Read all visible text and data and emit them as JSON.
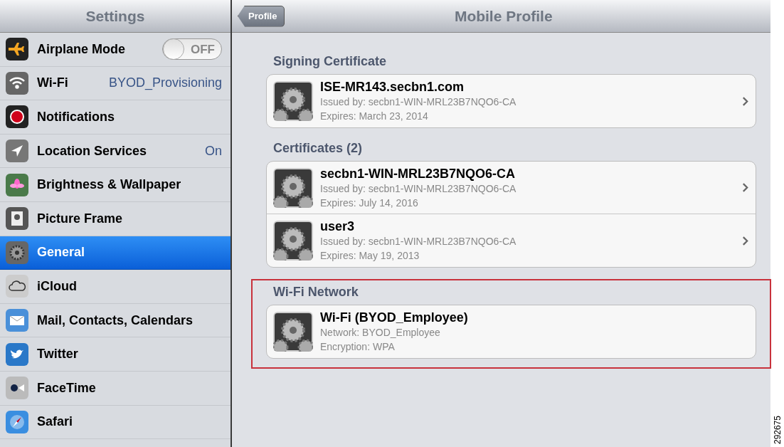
{
  "sidebar": {
    "title": "Settings",
    "items": [
      {
        "label": "Airplane Mode",
        "kind": "toggle",
        "on": false,
        "toggle_text": "OFF",
        "selected": false
      },
      {
        "label": "Wi-Fi",
        "kind": "value",
        "value": "BYOD_Provisioning",
        "selected": false
      },
      {
        "label": "Notifications",
        "kind": "plain",
        "selected": false
      },
      {
        "label": "Location Services",
        "kind": "value",
        "value": "On",
        "selected": false
      },
      {
        "label": "Brightness & Wallpaper",
        "kind": "plain",
        "selected": false
      },
      {
        "label": "Picture Frame",
        "kind": "plain",
        "selected": false
      },
      {
        "label": "General",
        "kind": "plain",
        "selected": true
      },
      {
        "label": "iCloud",
        "kind": "plain",
        "selected": false
      },
      {
        "label": "Mail, Contacts, Calendars",
        "kind": "plain",
        "selected": false
      },
      {
        "label": "Twitter",
        "kind": "plain",
        "selected": false
      },
      {
        "label": "FaceTime",
        "kind": "plain",
        "selected": false
      },
      {
        "label": "Safari",
        "kind": "plain",
        "selected": false
      }
    ]
  },
  "detail": {
    "back_button": "Profile",
    "title": "Mobile Profile",
    "sections": [
      {
        "heading": "Signing Certificate",
        "highlighted": false,
        "items": [
          {
            "name": "ISE-MR143.secbn1.com",
            "lines": [
              "Issued by: secbn1-WIN-MRL23B7NQO6-CA",
              "Expires: March 23, 2014"
            ],
            "disclosure": true
          }
        ]
      },
      {
        "heading": "Certificates (2)",
        "highlighted": false,
        "items": [
          {
            "name": "secbn1-WIN-MRL23B7NQO6-CA",
            "lines": [
              "Issued by: secbn1-WIN-MRL23B7NQO6-CA",
              "Expires: July 14, 2016"
            ],
            "disclosure": true
          },
          {
            "name": "user3",
            "lines": [
              "Issued by: secbn1-WIN-MRL23B7NQO6-CA",
              "Expires: May 19, 2013"
            ],
            "disclosure": true
          }
        ]
      },
      {
        "heading": "Wi-Fi Network",
        "highlighted": true,
        "items": [
          {
            "name": "Wi-Fi (BYOD_Employee)",
            "lines": [
              "Network: BYOD_Employee",
              "Encryption: WPA"
            ],
            "disclosure": false
          }
        ]
      }
    ]
  },
  "figure_number": "292675"
}
